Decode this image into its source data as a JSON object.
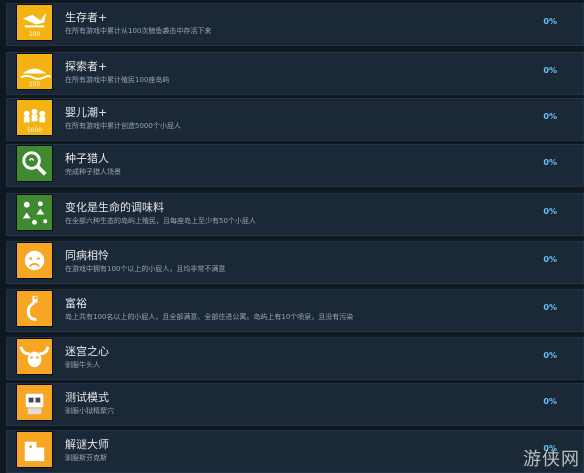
{
  "achievements": [
    {
      "title": "生存者+",
      "desc": "在所有游戏中累计从100次鲸鱼袭击中存活下来",
      "percent": "0%",
      "icon": "whale-survivor-icon",
      "icon_color": "#f2b313"
    },
    {
      "title": "探索者+",
      "desc": "在所有游戏中累计殖民100座岛屿",
      "percent": "0%",
      "icon": "island-explorer-icon",
      "icon_color": "#f2b313"
    },
    {
      "title": "婴儿潮+",
      "desc": "在所有游戏中累计创造5000个小屁人",
      "percent": "0%",
      "icon": "baby-boom-icon",
      "icon_color": "#f2b313"
    },
    {
      "title": "种子猎人",
      "desc": "完成种子猎人场景",
      "percent": "0%",
      "icon": "magnifier-seed-icon",
      "icon_color": "#3f8a2e"
    },
    {
      "title": "变化是生命的调味料",
      "desc": "在全部六种生态的岛屿上殖民，且每座岛上至少有50个小屁人",
      "percent": "0%",
      "icon": "biome-spice-icon",
      "icon_color": "#3f8a2e"
    },
    {
      "title": "同病相怜",
      "desc": "在游戏中拥有100个以上的小屁人，且均非常不满意",
      "percent": "0%",
      "icon": "sad-face-icon",
      "icon_color": "#f6a623"
    },
    {
      "title": "富裕",
      "desc": "岛上共有100名以上的小屁人，且全部满意、全部住进公寓。岛屿上有10个喷泉，且没有污染",
      "percent": "0%",
      "icon": "wealth-bomb-icon",
      "icon_color": "#f6a623"
    },
    {
      "title": "迷宫之心",
      "desc": "驯服牛头人",
      "percent": "0%",
      "icon": "minotaur-icon",
      "icon_color": "#f6a623"
    },
    {
      "title": "测试模式",
      "desc": "驯服小狱精聚穴",
      "percent": "0%",
      "icon": "test-robot-icon",
      "icon_color": "#f6a623"
    },
    {
      "title": "解谜大师",
      "desc": "驯服斯芬克斯",
      "percent": "0%",
      "icon": "puzzle-sphinx-icon",
      "icon_color": "#f6a623"
    }
  ],
  "watermark": "游侠网"
}
